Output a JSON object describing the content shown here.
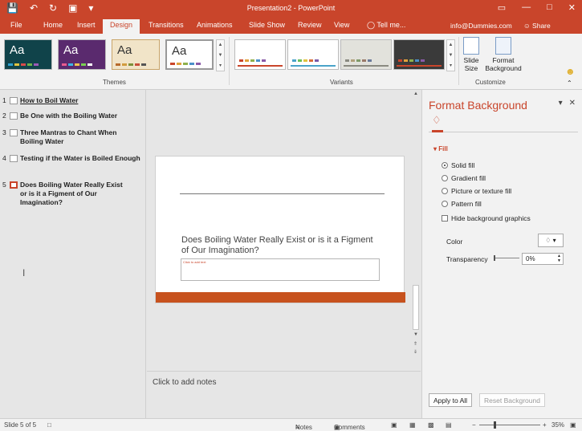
{
  "window": {
    "title": "Presentation2 - PowerPoint",
    "qat_icons": [
      "save-icon",
      "undo-icon",
      "redo-icon",
      "present-icon",
      "customize-icon"
    ],
    "controls": [
      "restore-ribbon-icon",
      "minimize-icon",
      "maximize-icon",
      "close-icon"
    ],
    "colors": {
      "brand": "#c9452b",
      "accent_bar": "#c7521e"
    }
  },
  "ribbon": {
    "tabs": [
      "File",
      "Home",
      "Insert",
      "Design",
      "Transitions",
      "Animations",
      "Slide Show",
      "Review",
      "View"
    ],
    "active_tab": "Design",
    "tell_me": "Tell me...",
    "account": "info@Dummies.com",
    "share": "Share",
    "themes_label": "Themes",
    "variants_label": "Variants",
    "customize_label": "Customize",
    "theme_thumb_text": "Aa",
    "slide_size_label": "Slide Size",
    "format_bg_label": "Format Background"
  },
  "outline": {
    "items": [
      {
        "num": "1",
        "text": "How to Boil Water"
      },
      {
        "num": "2",
        "text": "Be One with the Boiling Water"
      },
      {
        "num": "3",
        "text": "Three Mantras to Chant When Boiling Water"
      },
      {
        "num": "4",
        "text": "Testing if the Water is Boiled Enough"
      },
      {
        "num": "5",
        "text": "Does Boiling Water Really Exist or is it a Figment of Our Imagination?"
      }
    ]
  },
  "slide": {
    "title": "Does Boiling Water Really Exist or is it a Figment of Our Imagination?",
    "subtitle_placeholder": "Click to add text"
  },
  "notes": {
    "placeholder": "Click to add notes"
  },
  "pane": {
    "title": "Format Background",
    "section": "Fill",
    "fill_options": [
      "Solid fill",
      "Gradient fill",
      "Picture or texture fill",
      "Pattern fill"
    ],
    "selected_fill": "Solid fill",
    "hide_graphics": "Hide background graphics",
    "color_label": "Color",
    "transparency_label": "Transparency",
    "transparency_value": "0%",
    "apply_all": "Apply to All",
    "reset": "Reset Background"
  },
  "status": {
    "slide_info": "Slide 5 of 5",
    "notes": "Notes",
    "comments": "Comments",
    "zoom": "35%"
  }
}
